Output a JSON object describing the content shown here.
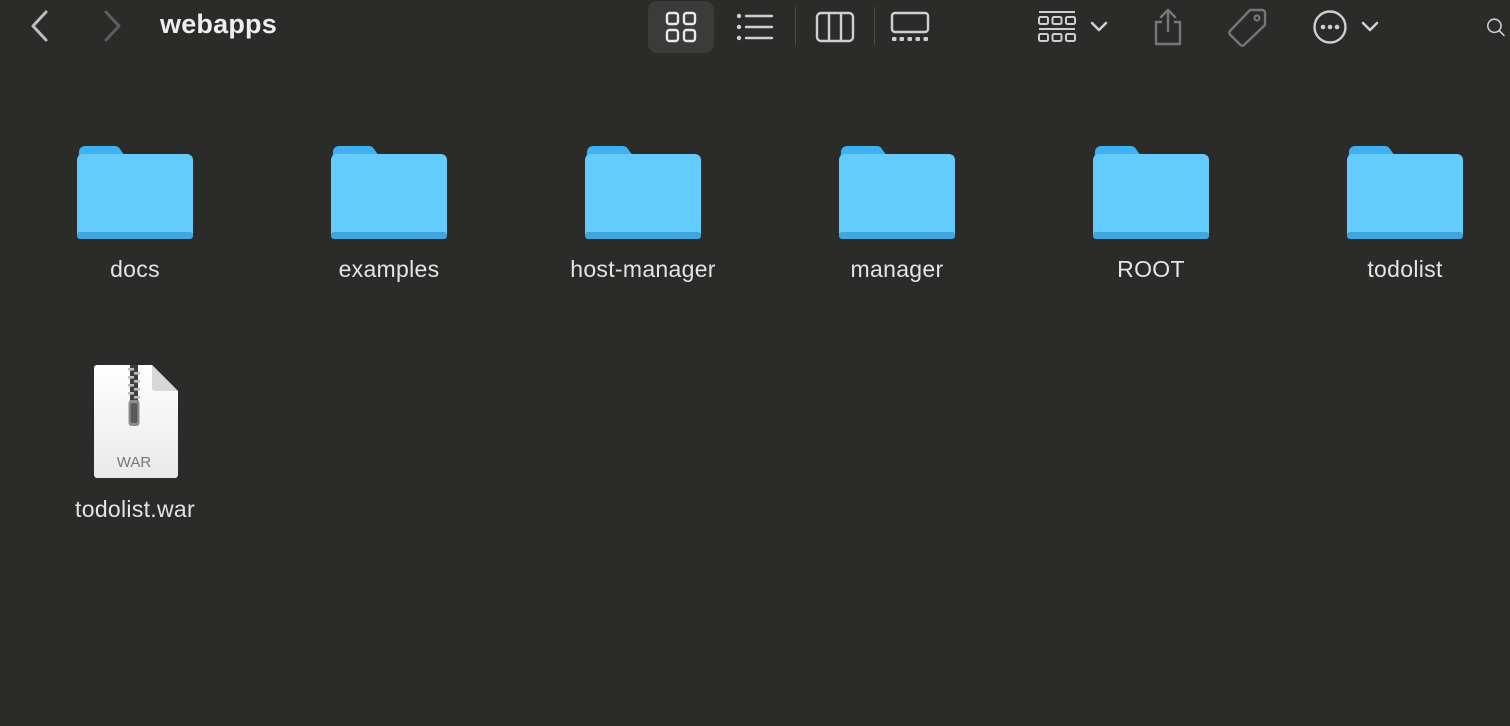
{
  "window": {
    "title": "webapps"
  },
  "toolbar": {
    "back_icon": "chevron-left-icon",
    "forward_icon": "chevron-right-icon",
    "views": [
      "icon-view-icon",
      "list-view-icon",
      "column-view-icon",
      "gallery-view-icon"
    ],
    "selected_view": "icon-view",
    "group_icon": "group-by-icon",
    "share_icon": "share-icon",
    "tag_icon": "tag-icon",
    "more_icon": "ellipsis-circle-icon",
    "search_icon": "search-icon"
  },
  "items": [
    {
      "name": "docs",
      "kind": "folder"
    },
    {
      "name": "examples",
      "kind": "folder"
    },
    {
      "name": "host-manager",
      "kind": "folder"
    },
    {
      "name": "manager",
      "kind": "folder"
    },
    {
      "name": "ROOT",
      "kind": "folder"
    },
    {
      "name": "todolist",
      "kind": "folder"
    },
    {
      "name": "todolist.war",
      "kind": "archive",
      "badge": "WAR"
    }
  ],
  "colors": {
    "background": "#2b2b2a",
    "folder_body": "#64cbfd",
    "folder_tab": "#3fb0f2",
    "text": "#e4e4e4"
  }
}
